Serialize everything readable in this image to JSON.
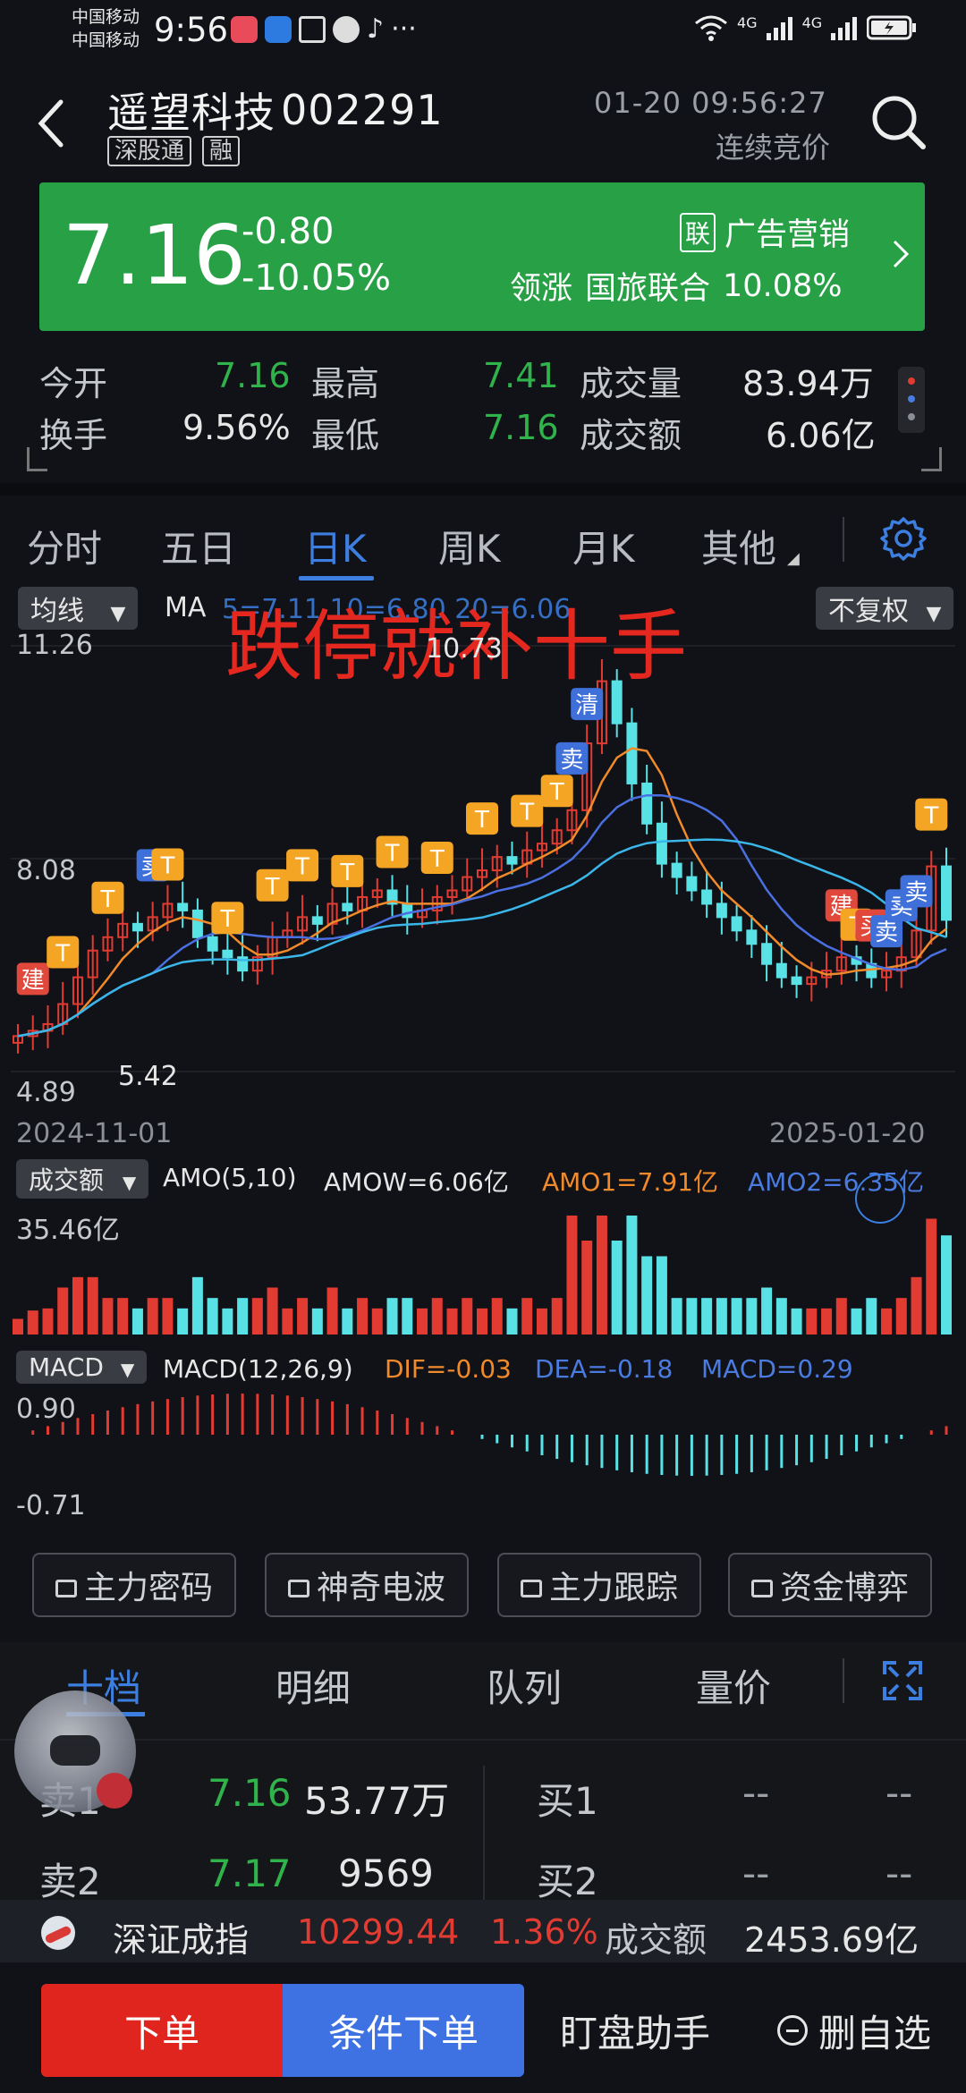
{
  "status_bar": {
    "carrier1": "中国移动",
    "carrier2": "中国移动",
    "time": "9:56",
    "net1": "4G",
    "net2": "4G"
  },
  "header": {
    "stock_name": "遥望科技",
    "stock_code": "002291",
    "tags": [
      "深股通",
      "融"
    ],
    "datetime": "01-20 09:56:27",
    "session": "连续竞价"
  },
  "quote": {
    "price": "7.16",
    "change": "-0.80",
    "change_pct": "-10.05%",
    "sector_badge": "联",
    "sector": "广告营销",
    "leader_label": "领涨",
    "leader_name": "国旅联合",
    "leader_pct": "10.08%"
  },
  "stats": {
    "open_label": "今开",
    "open": "7.16",
    "high_label": "最高",
    "high": "7.41",
    "volume_label": "成交量",
    "volume": "83.94万",
    "turnover_label": "换手",
    "turnover": "9.56%",
    "low_label": "最低",
    "low": "7.16",
    "amount_label": "成交额",
    "amount": "6.06亿"
  },
  "tabs": [
    "分时",
    "五日",
    "日K",
    "周K",
    "月K",
    "其他"
  ],
  "active_tab": "日K",
  "chart": {
    "ma_selector": "均线",
    "ma_label": "MA",
    "ma_values_partial": "5=7.11 10=6.80 20=6.06",
    "adjust_selector": "不复权",
    "watermark": "跌停就补十手",
    "y_top": "11.26",
    "y_mid": "8.08",
    "y_bottom": "4.89",
    "peak_label": "10.73",
    "low_label": "5.42",
    "date_start": "2024-11-01",
    "date_end": "2025-01-20",
    "vol_selector": "成交额",
    "vol_header": "AMO(5,10)",
    "amow": "AMOW=6.06亿",
    "amo1": "AMO1=7.91亿",
    "amo2": "AMO2=6.35亿",
    "vol_max": "35.46亿",
    "macd_selector": "MACD",
    "macd_header": "MACD(12,26,9)",
    "dif": "DIF=-0.03",
    "dea": "DEA=-0.18",
    "macd": "MACD=0.29",
    "macd_top": "0.90",
    "macd_bottom": "-0.71",
    "signal_labels": {
      "t": "T",
      "sell": "卖",
      "build": "建",
      "buy": "买",
      "clear": "清"
    }
  },
  "chart_data": {
    "type": "candlestick",
    "date_range": [
      "2024-11-01",
      "2025-01-20"
    ],
    "ylim": [
      4.89,
      11.26
    ],
    "closes": [
      5.42,
      5.5,
      5.6,
      5.9,
      6.3,
      6.7,
      6.9,
      7.1,
      7.0,
      7.2,
      7.4,
      7.3,
      6.9,
      6.7,
      6.6,
      6.4,
      6.6,
      6.9,
      7.0,
      7.2,
      7.1,
      7.4,
      7.3,
      7.5,
      7.6,
      7.4,
      7.2,
      7.3,
      7.5,
      7.6,
      7.8,
      7.9,
      8.1,
      8.0,
      8.2,
      8.3,
      8.5,
      8.8,
      9.8,
      10.73,
      10.1,
      9.2,
      8.6,
      8.0,
      7.8,
      7.6,
      7.4,
      7.2,
      7.0,
      6.8,
      6.5,
      6.3,
      6.2,
      6.3,
      6.4,
      6.6,
      6.5,
      6.3,
      6.4,
      6.6,
      7.0,
      7.96,
      7.16
    ],
    "volume_max_label": "35.46亿",
    "macd_range": [
      -0.71,
      0.9
    ]
  },
  "features": [
    "主力密码",
    "神奇电波",
    "主力跟踪",
    "资金博弈"
  ],
  "level_tabs": [
    "十档",
    "明细",
    "队列",
    "量价"
  ],
  "order_book": {
    "asks": [
      {
        "label": "卖1",
        "price": "7.16",
        "vol": "53.77万"
      },
      {
        "label": "卖2",
        "price": "7.17",
        "vol": "9569"
      }
    ],
    "bids": [
      {
        "label": "买1",
        "price": "--",
        "vol": "--"
      },
      {
        "label": "买2",
        "price": "--",
        "vol": "--"
      }
    ]
  },
  "index_bar": {
    "name": "深证成指",
    "value": "10299.44",
    "pct": "1.36%",
    "amount_label": "成交额",
    "amount": "2453.69亿"
  },
  "actions": {
    "order": "下单",
    "conditional": "条件下单",
    "watch": "盯盘助手",
    "remove": "删自选"
  }
}
